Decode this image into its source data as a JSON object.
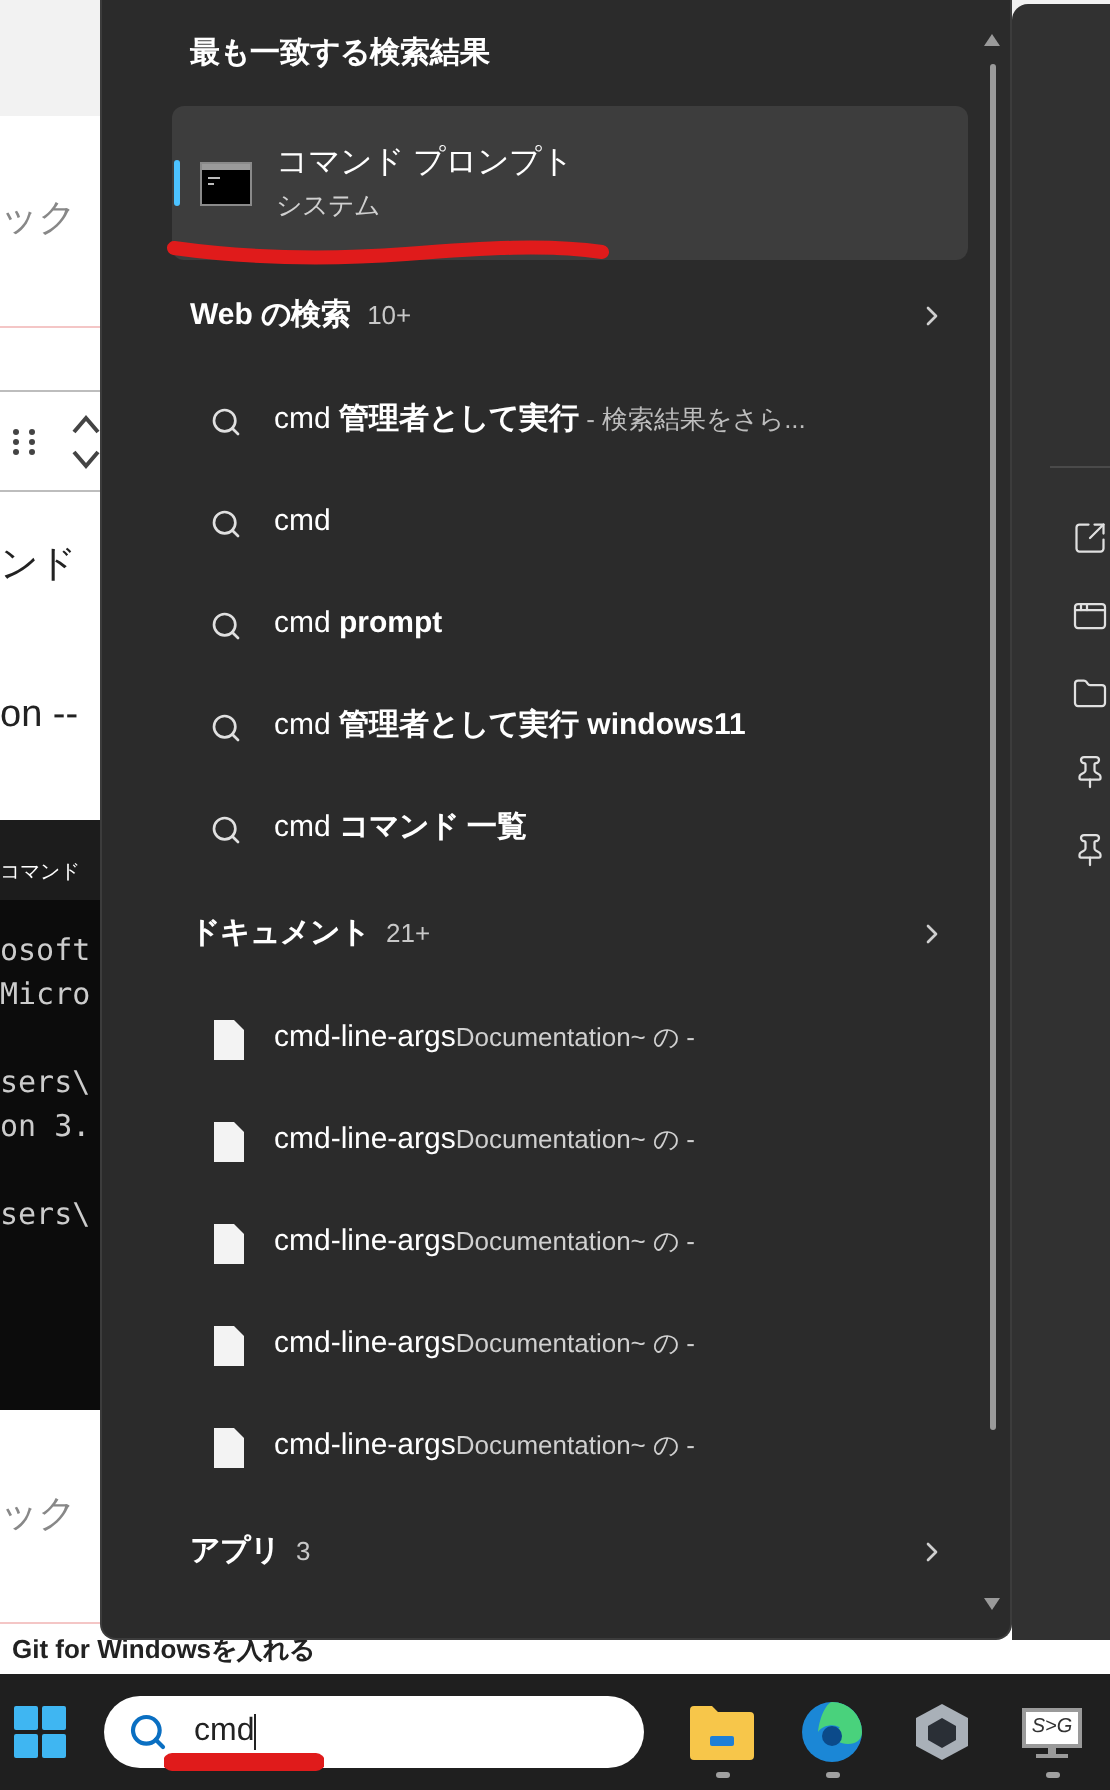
{
  "background_page": {
    "fragments_top": [
      "ック"
    ],
    "fragments_mid": [
      "ンド",
      "on --"
    ],
    "terminal": {
      "title": "コマンド",
      "paragraphs": [
        [
          "osoft",
          "Micro"
        ],
        [
          "sers\\",
          "on 3."
        ],
        [
          "sers\\"
        ]
      ]
    },
    "fragment_bottom": "ック",
    "heading": "Git for Windowsを入れる"
  },
  "search_panel": {
    "heading": "最も一致する検索結果",
    "best_match": {
      "title": "コマンド プロンプト",
      "subtitle": "システム",
      "selected": true
    },
    "sections": [
      {
        "kind": "web",
        "title": "Web の検索",
        "count": "10+",
        "items": [
          {
            "text": "cmd **管理者として実行**",
            "suffix": " - 検索結果をさら..."
          },
          {
            "text": "cmd"
          },
          {
            "text": "cmd **prompt**"
          },
          {
            "text": "cmd **管理者として実行 windows11**"
          },
          {
            "text": "cmd **コマンド 一覧**"
          }
        ]
      },
      {
        "kind": "documents",
        "title": "ドキュメント",
        "count": "21+",
        "items": [
          {
            "name": "cmd-line-args",
            "location": "Documentation~ の -"
          },
          {
            "name": "cmd-line-args",
            "location": "Documentation~ の -"
          },
          {
            "name": "cmd-line-args",
            "location": "Documentation~ の -"
          },
          {
            "name": "cmd-line-args",
            "location": "Documentation~ の -"
          },
          {
            "name": "cmd-line-args",
            "location": "Documentation~ の -"
          }
        ]
      },
      {
        "kind": "apps",
        "title": "アプリ",
        "count": "3"
      }
    ]
  },
  "taskbar": {
    "search": {
      "value": "cmd"
    },
    "apps": [
      {
        "kind": "folder",
        "running": true
      },
      {
        "kind": "browser",
        "running": true
      },
      {
        "kind": "cube",
        "running": false
      },
      {
        "kind": "monitor",
        "label": "S>G",
        "running": true
      }
    ]
  }
}
